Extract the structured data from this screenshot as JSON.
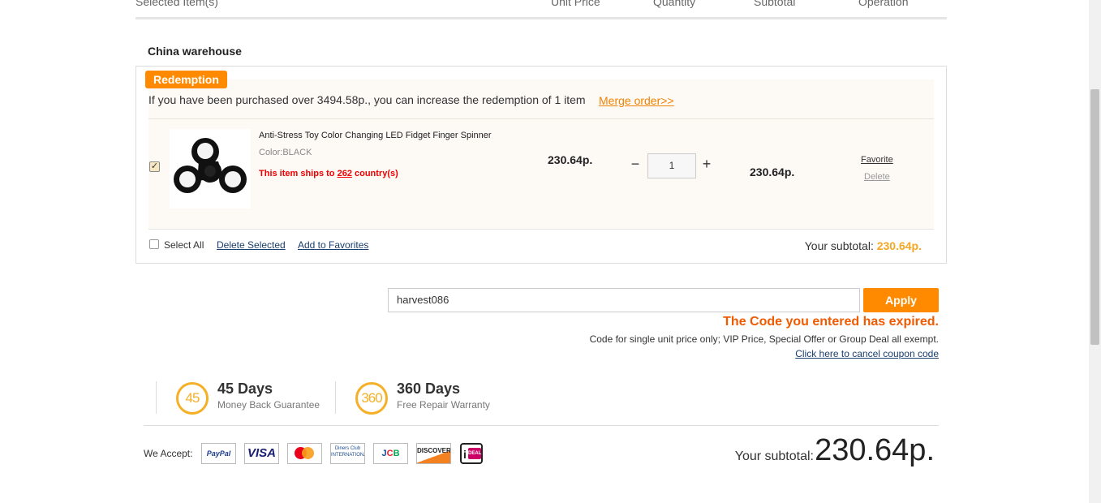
{
  "header": {
    "selected_items": "Selected Item(s)",
    "unit_price": "Unit Price",
    "quantity": "Quantity",
    "subtotal": "Subtotal",
    "operation": "Operation"
  },
  "warehouse": {
    "title": "China warehouse"
  },
  "redemption": {
    "badge": "Redemption",
    "text": "If you have been purchased over 3494.58p., you can increase the redemption of 1 item",
    "merge_link": "Merge order>>"
  },
  "item": {
    "checked": "✓",
    "name": "Anti-Stress Toy Color Changing LED Fidget Finger Spinner",
    "color": "Color:BLACK",
    "ships_prefix": "This item ships to ",
    "ships_count": "262",
    "ships_suffix": " country(s)",
    "unit_price": "230.64p.",
    "qty_minus": "−",
    "quantity": "1",
    "qty_plus": "+",
    "subtotal": "230.64p.",
    "favorite": "Favorite",
    "delete": "Delete"
  },
  "cart_footer": {
    "select_all": "Select All",
    "delete_selected": "Delete Selected",
    "add_to_favorites": "Add to Favorites",
    "subtotal_label": "Your subtotal: ",
    "subtotal_amount": "230.64p."
  },
  "coupon": {
    "value": "harvest086",
    "apply_label": "Apply",
    "error": "The Code you entered has expired.",
    "note": "Code for single unit price only; VIP Price, Special Offer or Group Deal all exempt.",
    "cancel_link": "Click here to cancel coupon code"
  },
  "guarantees": [
    {
      "badge": "45",
      "title": "45 Days",
      "subtitle": "Money Back Guarantee"
    },
    {
      "badge": "360",
      "title": "360 Days",
      "subtitle": "Free Repair Warranty"
    }
  ],
  "payments": {
    "label": "We Accept:",
    "paypal": "PayPal",
    "visa": "VISA",
    "diners": "Diners Club INTERNATIONAL",
    "jcb_j": "J",
    "jcb_c": "C",
    "jcb_b": "B",
    "discover": "DISCOVER",
    "ideal_i": "i",
    "ideal_d": "DEAL"
  },
  "grand_total": {
    "label": "Your subtotal:",
    "amount": "230.64p."
  },
  "colors": {
    "accent": "#ff8a00",
    "error": "#f05a00",
    "price_highlight": "#f5a623",
    "link": "#1a3e6d",
    "ships_red": "#e00000"
  }
}
